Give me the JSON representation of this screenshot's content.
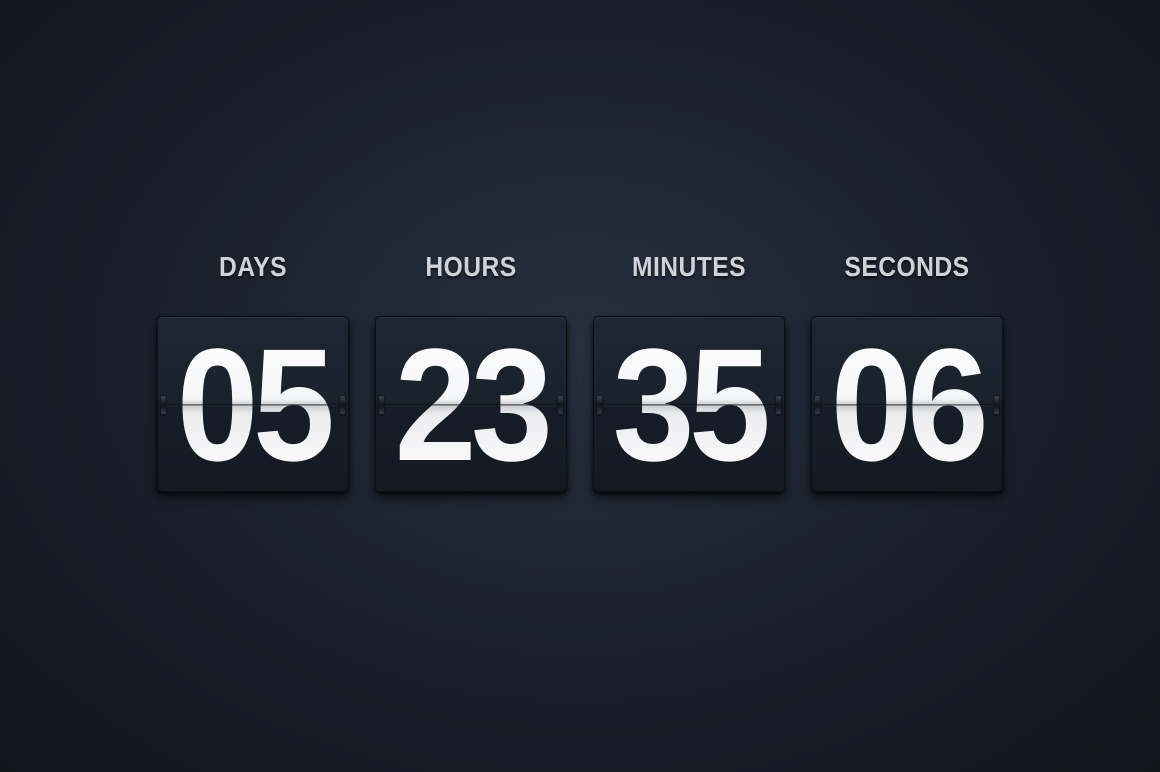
{
  "countdown": {
    "units": [
      {
        "label": "DAYS",
        "value": "05"
      },
      {
        "label": "HOURS",
        "value": "23"
      },
      {
        "label": "MINUTES",
        "value": "35"
      },
      {
        "label": "SECONDS",
        "value": "06"
      }
    ]
  },
  "colors": {
    "background": "#1b222c",
    "card": "#1a222c",
    "label": "#cfd3d8",
    "digit": "#ffffff"
  }
}
